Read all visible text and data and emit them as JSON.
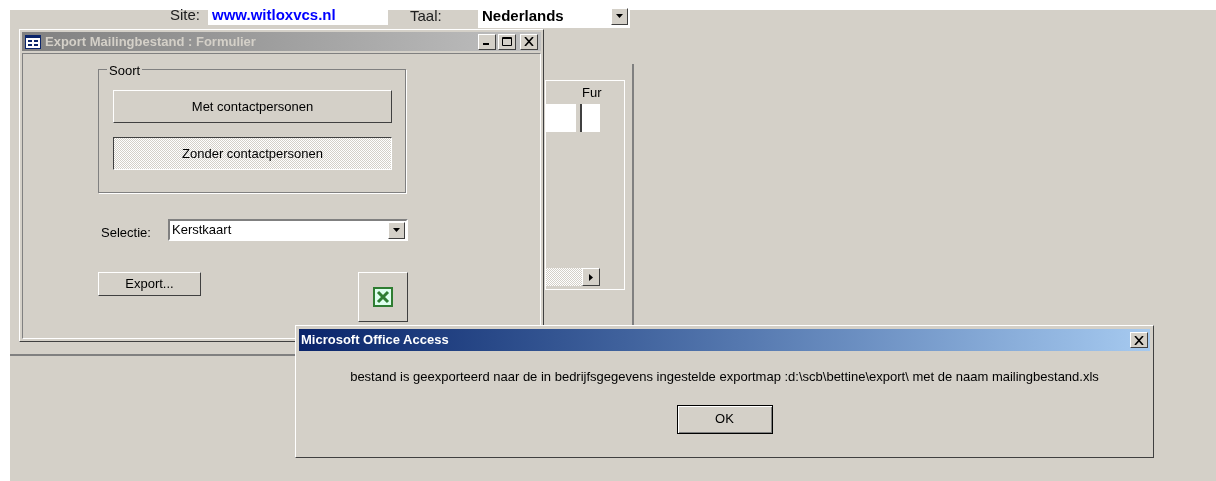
{
  "background_form": {
    "site_label": "Site:",
    "site_value": "www.witloxvcs.nl",
    "language_label": "Taal:",
    "language_value": "Nederlands",
    "column_header": "Fur"
  },
  "export_window": {
    "title": "Export Mailingbestand : Formulier",
    "active": false,
    "group_label": "Soort",
    "options": [
      {
        "label": "Met contactpersonen",
        "selected": false
      },
      {
        "label": "Zonder contactpersonen",
        "selected": true
      }
    ],
    "selection_label": "Selectie:",
    "selection_value": "Kerstkaart",
    "export_button": "Export..."
  },
  "dialog": {
    "title": "Microsoft Office Access",
    "active": true,
    "message": "bestand is geexporteerd naar de in bedrijfsgegevens ingestelde exportmap :d:\\scb\\bettine\\export\\ met de naam mailingbestand.xls",
    "ok_button": "OK"
  }
}
